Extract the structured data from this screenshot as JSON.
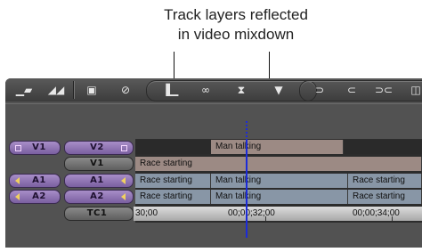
{
  "callout": {
    "line1": "Track layers reflected",
    "line2": "in video mixdown"
  },
  "toolbar": {
    "icons": [
      "segment-mode-icon",
      "lift-overwrite-icon",
      "monitor-icon",
      "no-entry-icon",
      "trim-icon",
      "splice-icon",
      "keyframe-icon",
      "marker-icon",
      "mark-in-icon",
      "mark-out-icon",
      "mark-clip-icon",
      "clear-icon"
    ]
  },
  "track_selector": {
    "source": [
      {
        "label": "V1"
      },
      {
        "label": "A1"
      },
      {
        "label": "A2"
      }
    ],
    "record": [
      {
        "label": "V2"
      },
      {
        "label": "V1"
      },
      {
        "label": "A1"
      },
      {
        "label": "A2"
      },
      {
        "label": "TC1"
      }
    ]
  },
  "timeline": {
    "tracks": {
      "V2": [
        {
          "label": "Man talking"
        }
      ],
      "V1": [
        {
          "label": "Race starting"
        }
      ],
      "A1": [
        {
          "label": "Race starting"
        },
        {
          "label": "Man talking"
        },
        {
          "label": "Race starting"
        }
      ],
      "A2": [
        {
          "label": "Race starting"
        },
        {
          "label": "Man talking"
        },
        {
          "label": "Race starting"
        }
      ]
    },
    "timecodes": [
      "30;00",
      "00;00;32;00",
      "00;00;34;00"
    ]
  },
  "colors": {
    "video_clip": "#9c8a84",
    "audio_clip": "#8896a6",
    "playhead": "#1c2bd8",
    "active_track_pill": "#a88ec8"
  }
}
